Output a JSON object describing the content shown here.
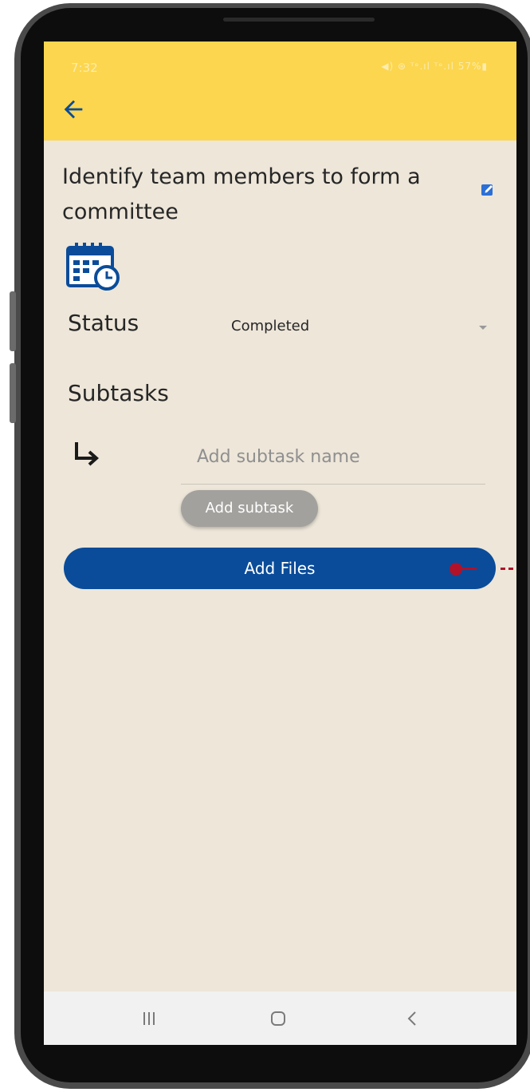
{
  "status_bar": {
    "time": "7:32",
    "indicators": "◀) ⊛ ᵀᵉ.ıl ᵀᵉ.ıl 57%▮",
    "battery": "57%"
  },
  "header": {
    "back_icon": "arrow-left-icon",
    "accent_color": "#fcd64e"
  },
  "task": {
    "title": "Identify team members to form a committee",
    "edit_icon": "edit-checkbox-icon",
    "calendar_icon": "calendar-clock-icon"
  },
  "status": {
    "label": "Status",
    "value": "Completed"
  },
  "subtasks": {
    "label": "Subtasks",
    "arrow_icon": "subdirectory-arrow-icon",
    "input_placeholder": "Add subtask name",
    "add_button_label": "Add subtask"
  },
  "files": {
    "add_button_label": "Add Files",
    "button_color": "#0a4c9a"
  },
  "nav_bar": {
    "recents_icon": "recents-icon",
    "home_icon": "home-icon",
    "back_icon": "chevron-left-icon"
  }
}
